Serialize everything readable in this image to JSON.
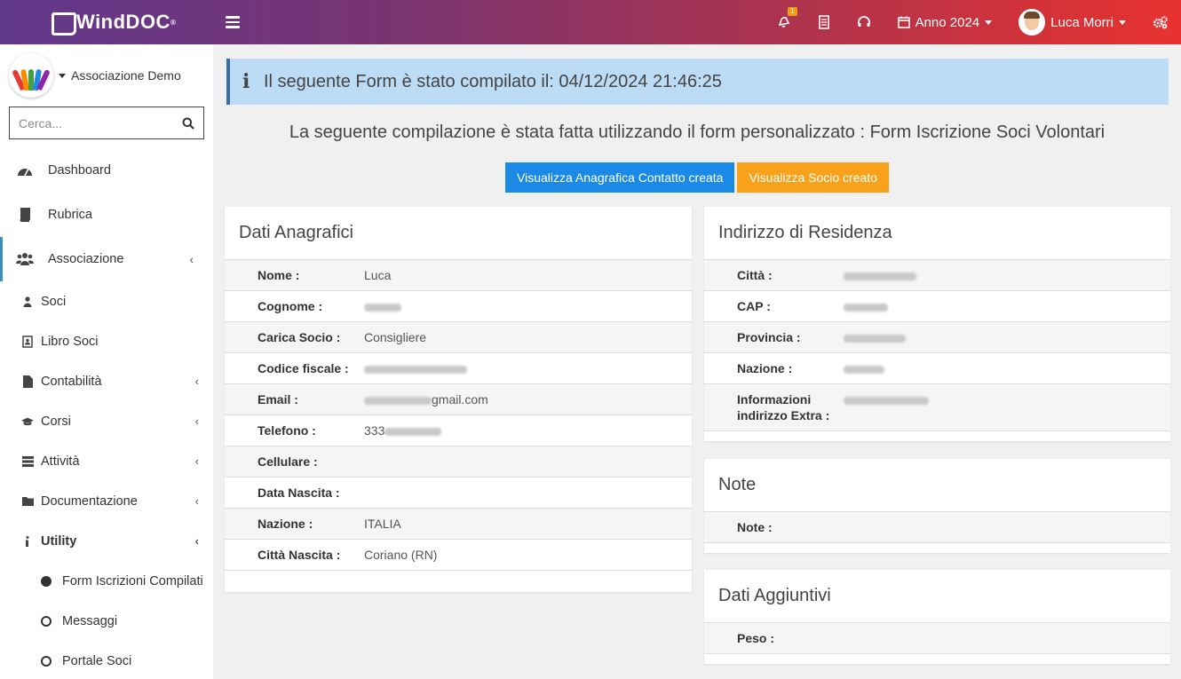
{
  "app": {
    "logo_text": "WindDOC",
    "logo_sup": "®"
  },
  "topbar": {
    "notification_count": "1",
    "year_label": "Anno 2024",
    "user_name": "Luca Morri"
  },
  "sidebar": {
    "org_name": "Associazione Demo",
    "search_placeholder": "Cerca...",
    "items": {
      "dashboard": "Dashboard",
      "rubrica": "Rubrica",
      "associazione": "Associazione",
      "soci": "Soci",
      "libro_soci": "Libro Soci",
      "contabilita": "Contabilità",
      "corsi": "Corsi",
      "attivita": "Attività",
      "documentazione": "Documentazione",
      "utility": "Utility",
      "form_iscrizioni": "Form Iscrizioni Compilati",
      "messaggi": "Messaggi",
      "portale_soci": "Portale Soci"
    },
    "chevron": "‹"
  },
  "main": {
    "info_text": "Il seguente Form è stato compilato il: 04/12/2024 21:46:25",
    "subtitle": "La seguente compilazione è stata fatta utilizzando il form personalizzato : Form Iscrizione Soci Volontari",
    "btn_contact": "Visualizza Anagrafica Contatto creata",
    "btn_socio": "Visualizza Socio creato"
  },
  "anagrafici": {
    "title": "Dati Anagrafici",
    "nome_label": "Nome :",
    "nome_value": "Luca",
    "cognome_label": "Cognome :",
    "carica_label": "Carica Socio :",
    "carica_value": "Consigliere",
    "cf_label": "Codice fiscale :",
    "email_label": "Email :",
    "email_value": "gmail.com",
    "telefono_label": "Telefono :",
    "telefono_value": "333",
    "cellulare_label": "Cellulare :",
    "nascita_label": "Data Nascita :",
    "nazione_label": "Nazione :",
    "nazione_value": "ITALIA",
    "citta_label": "Città Nascita :",
    "citta_value": "Coriano (RN)"
  },
  "residenza": {
    "title": "Indirizzo di Residenza",
    "citta_label": "Città :",
    "cap_label": "CAP :",
    "provincia_label": "Provincia :",
    "nazione_label": "Nazione :",
    "extra_label": "Informazioni indirizzo Extra :"
  },
  "note": {
    "title": "Note",
    "note_label": "Note :"
  },
  "aggiuntivi": {
    "title": "Dati Aggiuntivi",
    "peso_label": "Peso :"
  }
}
